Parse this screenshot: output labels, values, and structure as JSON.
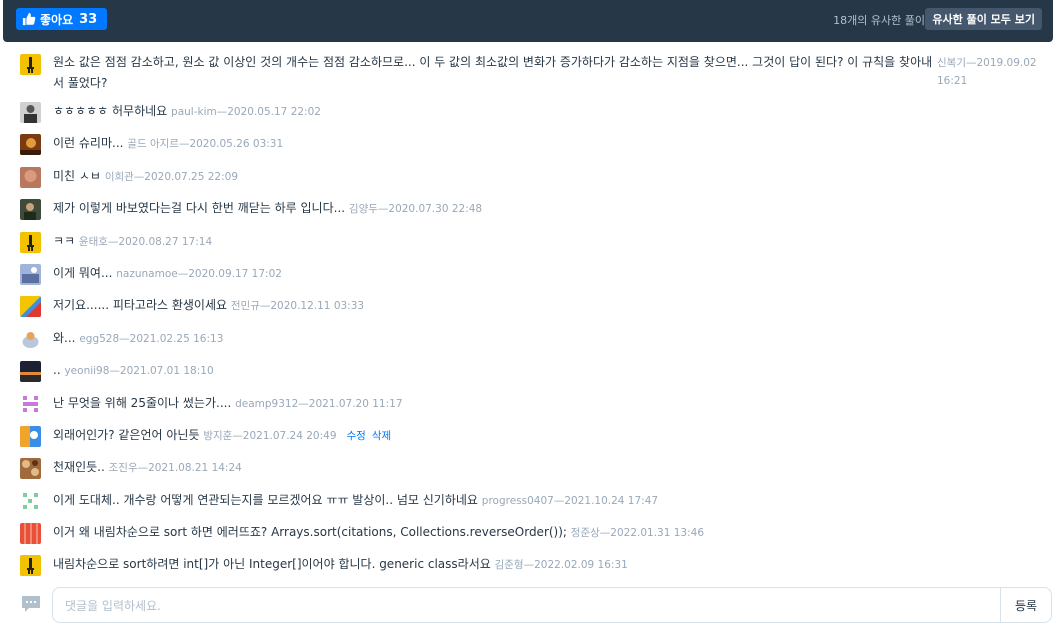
{
  "header": {
    "like_label": "좋아요",
    "like_count": "33",
    "similar_count_text": "18개의 유사한 풀이",
    "similar_button": "유사한 풀이 모두 보기"
  },
  "comments": [
    {
      "text": "원소 값은 점점 감소하고, 원소 값 이상인 것의 개수는 점점 감소하므로... 이 두 값의 최소값의 변화가 증가하다가 감소하는 지점을 찾으면... 그것이 답이 된다? 이 규칙을 찾아내서 풀었다?",
      "author": "신복기",
      "date": "2019.09.02 16:21"
    },
    {
      "text": "ㅎㅎㅎㅎㅎ 허무하네요",
      "author": "paul-kim",
      "date": "2020.05.17 22:02"
    },
    {
      "text": "이런 슈리마...",
      "author": "골드 아지르",
      "date": "2020.05.26 03:31"
    },
    {
      "text": "미친 ㅅㅂ",
      "author": "이희관",
      "date": "2020.07.25 22:09"
    },
    {
      "text": "제가 이렇게 바보였다는걸 다시 한번 깨닫는 하루 입니다...",
      "author": "김양두",
      "date": "2020.07.30 22:48"
    },
    {
      "text": "ㅋㅋ",
      "author": "윤태호",
      "date": "2020.08.27 17:14"
    },
    {
      "text": "이게 뭐여...",
      "author": "nazunamoe",
      "date": "2020.09.17 17:02"
    },
    {
      "text": "저기요...... 피타고라스 환생이세요",
      "author": "전민규",
      "date": "2020.12.11 03:33"
    },
    {
      "text": "와...",
      "author": "egg528",
      "date": "2021.02.25 16:13"
    },
    {
      "text": "..",
      "author": "yeonii98",
      "date": "2021.07.01 18:10"
    },
    {
      "text": "난 무엇을 위해 25줄이나 썼는가....",
      "author": "deamp9312",
      "date": "2021.07.20 11:17"
    },
    {
      "text": "외래어인가? 같은언어 아닌듯",
      "author": "방지훈",
      "date": "2021.07.24 20:49",
      "edit": "수정",
      "delete": "삭제"
    },
    {
      "text": "천재인듯..",
      "author": "조진우",
      "date": "2021.08.21 14:24"
    },
    {
      "text": "이게 도대체.. 개수랑 어떻게 연관되는지를 모르겠어요 ㅠㅠ 발상이.. 넘모 신기하네요",
      "author": "progress0407",
      "date": "2021.10.24 17:47"
    },
    {
      "text": "이거 왜 내림차순으로 sort 하면 에러뜨죠? Arrays.sort(citations, Collections.reverseOrder());",
      "author": "정준상",
      "date": "2022.01.31 13:46"
    },
    {
      "text": "내림차순으로 sort하려면 int[]가 아닌 Integer[]이어야 합니다. generic class라서요",
      "author": "김준형",
      "date": "2022.02.09 16:31"
    }
  ],
  "input": {
    "placeholder": "댓글을 입력하세요.",
    "submit": "등록"
  },
  "colors": {
    "header_bg": "#263747",
    "accent": "#0078ff",
    "meta": "#98a8b9"
  }
}
